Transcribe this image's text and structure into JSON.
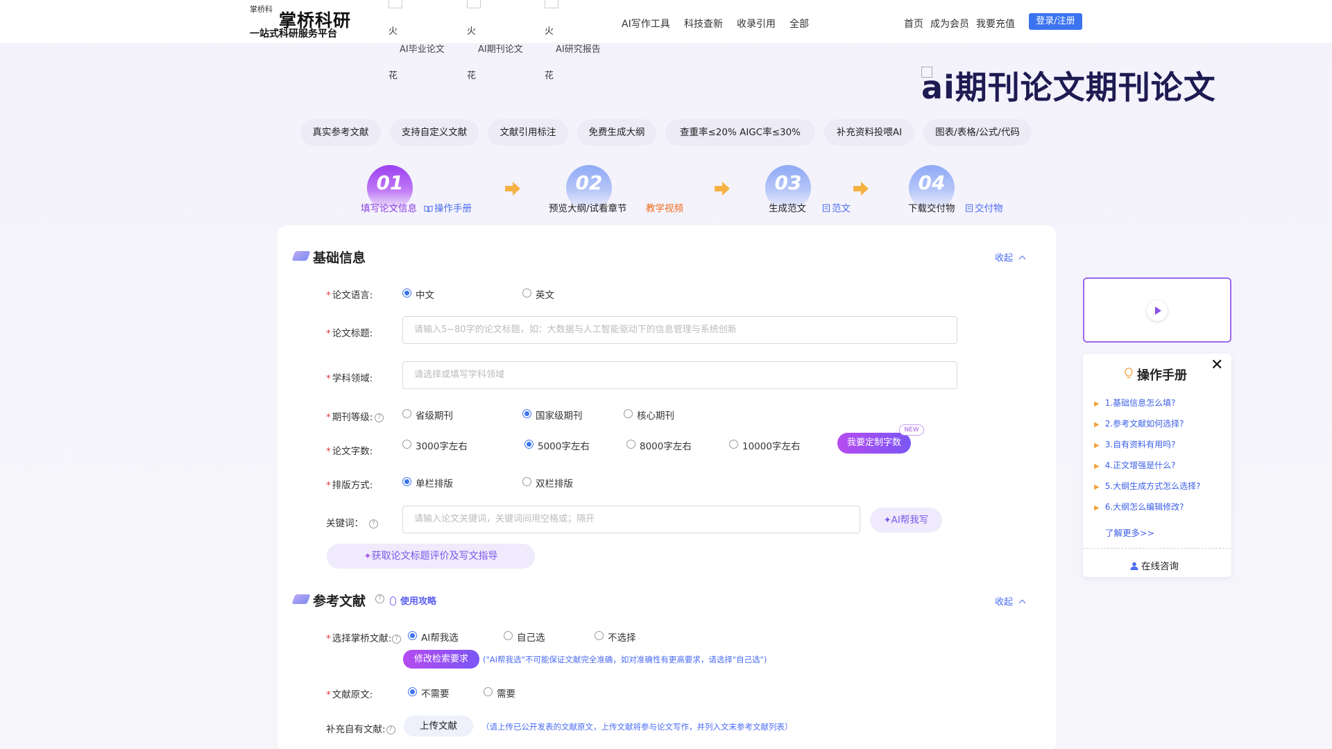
{
  "header": {
    "logo_alt": "掌桥科",
    "brand": "掌桥科研",
    "slogan": "一站式科研服务平台",
    "product_tabs": [
      {
        "fire": "火",
        "label": "AI毕业论文",
        "fire2": "花"
      },
      {
        "fire": "火",
        "label": "AI期刊论文",
        "fire2": "花"
      },
      {
        "fire": "火",
        "label": "AI研究报告",
        "fire2": "花"
      }
    ],
    "nav_mid": [
      "AI写作工具",
      "科技查新",
      "收录引用",
      "全部"
    ],
    "nav_right": [
      "首页",
      "成为会员",
      "我要充值"
    ],
    "login": "登录/注册"
  },
  "hero": {
    "title": "ai期刊论文期刊论文"
  },
  "tags": [
    "真实参考文献",
    "支持自定义文献",
    "文献引用标注",
    "免费生成大纲",
    "查重率≤20%  AIGC率≤30%",
    "补充资料投喂AI",
    "图表/表格/公式/代码"
  ],
  "steps": [
    {
      "num": "01",
      "label": "填写论文信息",
      "link": "操作手册"
    },
    {
      "num": "02",
      "label": "预览大纲/试看章节",
      "link": "教学视频"
    },
    {
      "num": "03",
      "label": "生成范文",
      "link": "范文"
    },
    {
      "num": "04",
      "label": "下载交付物",
      "link": "交付物"
    }
  ],
  "basic": {
    "title": "基础信息",
    "collapse": "收起",
    "language": {
      "label": "论文语言:",
      "options": [
        "中文",
        "英文"
      ],
      "selected": "中文"
    },
    "paper_title": {
      "label": "论文标题:",
      "placeholder": "请输入5~80字的论文标题，如：大数据与人工智能驱动下的信息管理与系统创新"
    },
    "subject": {
      "label": "学科领域:",
      "placeholder": "请选择或填写学科领域"
    },
    "journal_level": {
      "label": "期刊等级:",
      "options": [
        "省级期刊",
        "国家级期刊",
        "核心期刊"
      ],
      "selected": "国家级期刊"
    },
    "word_count": {
      "label": "论文字数:",
      "options": [
        "3000字左右",
        "5000字左右",
        "8000字左右",
        "10000字左右"
      ],
      "selected": "5000字左右",
      "custom_button": "我要定制字数",
      "badge": "NEW"
    },
    "layout": {
      "label": "排版方式:",
      "options": [
        "单栏排版",
        "双栏排版"
      ],
      "selected": "单栏排版"
    },
    "keywords": {
      "label": "关键词：",
      "placeholder": "请输入论文关键词，关键词间用空格或；隔开",
      "ai_button": "AI帮我写"
    },
    "guide_button": "获取论文标题评价及写文指导"
  },
  "references": {
    "title": "参考文献",
    "strategy": "使用攻略",
    "collapse": "收起",
    "select": {
      "label": "选择掌桥文献:",
      "options": [
        "AI帮我选",
        "自己选",
        "不选择"
      ],
      "selected": "AI帮我选"
    },
    "modify_button": "修改检索要求",
    "modify_hint": "(\"AI帮我选\"不可能保证文献完全准确，如对准确性有更高要求，请选择\"自己选\")",
    "original": {
      "label": "文献原文:",
      "options": [
        "不需要",
        "需要"
      ],
      "selected": "不需要"
    },
    "supplement": {
      "label": "补充自有文献:",
      "button": "上传文献",
      "hint": "（请上传已公开发表的文献原文，上传文献将参与论文写作，并列入文末参考文献列表）"
    }
  },
  "manual": {
    "title": "操作手册",
    "items": [
      "1.基础信息怎么填?",
      "2.参考文献如何选择?",
      "3.自有资料有用吗?",
      "4.正文增强是什么?",
      "5.大纲生成方式怎么选择?",
      "6.大纲怎么编辑修改?"
    ],
    "more": "了解更多>>",
    "consult": "在线咨询"
  },
  "colors": {
    "accent": "#3b73f0",
    "purple": "#8c3fe0",
    "orange": "#ee6b1f",
    "star": "#e03838"
  }
}
